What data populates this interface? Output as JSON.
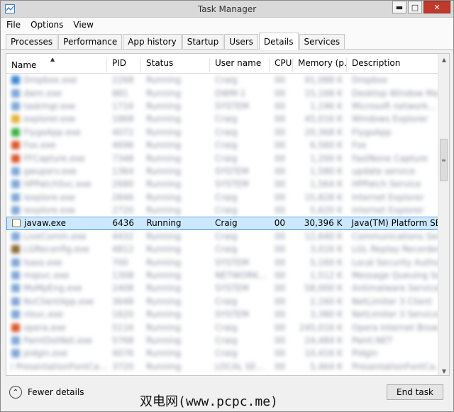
{
  "window": {
    "title": "Task Manager",
    "minimize": "▬",
    "maximize": "□",
    "close": "✕"
  },
  "menu": [
    "File",
    "Options",
    "View"
  ],
  "tabs": [
    "Processes",
    "Performance",
    "App history",
    "Startup",
    "Users",
    "Details",
    "Services"
  ],
  "active_tab": "Details",
  "columns": {
    "name": "Name",
    "pid": "PID",
    "status": "Status",
    "user": "User name",
    "cpu": "CPU",
    "memory": "Memory (p...",
    "description": "Description"
  },
  "selected_row": {
    "name": "javaw.exe",
    "pid": "6436",
    "status": "Running",
    "user": "Craig",
    "cpu": "00",
    "memory": "30,396 K",
    "description": "Java(TM) Platform SE..."
  },
  "blurred_rows": [
    {
      "icon_color": "#3a86d4",
      "name": "Dropbox.exe",
      "pid": "2268",
      "status": "Running",
      "user": "Craig",
      "cpu": "00",
      "mem": "91,088 K",
      "desc": "Dropbox"
    },
    {
      "icon_color": "#7fa7d6",
      "name": "dwm.exe",
      "pid": "881",
      "status": "Running",
      "user": "DWM-1",
      "cpu": "00",
      "mem": "15,168 K",
      "desc": "Desktop Window Ma..."
    },
    {
      "icon_color": "#7fa7d6",
      "name": "taskmgr.exe",
      "pid": "1716",
      "status": "Running",
      "user": "SYSTEM",
      "cpu": "00",
      "mem": "1,196 K",
      "desc": "Microsoft network..."
    },
    {
      "icon_color": "#e2b33a",
      "name": "explorer.exe",
      "pid": "1868",
      "status": "Running",
      "user": "Craig",
      "cpu": "00",
      "mem": "45,016 K",
      "desc": "Windows Explorer"
    },
    {
      "icon_color": "#3cb043",
      "name": "FlygoApp.exe",
      "pid": "4072",
      "status": "Running",
      "user": "Craig",
      "cpu": "00",
      "mem": "20,368 K",
      "desc": "FlygoApp"
    },
    {
      "icon_color": "#d9572f",
      "name": "Fox.exe",
      "pid": "4696",
      "status": "Running",
      "user": "Craig",
      "cpu": "00",
      "mem": "6,560 K",
      "desc": "Fox"
    },
    {
      "icon_color": "#d9572f",
      "name": "FFCapture.exe",
      "pid": "7348",
      "status": "Running",
      "user": "Craig",
      "cpu": "00",
      "mem": "1,200 K",
      "desc": "FastNone Capture"
    },
    {
      "icon_color": "#7fa7d6",
      "name": "gwupsrv.exe",
      "pid": "1364",
      "status": "Running",
      "user": "SYSTEM",
      "cpu": "00",
      "mem": "1,580 K",
      "desc": "update service"
    },
    {
      "icon_color": "#7fa7d6",
      "name": "HPPatchSvc.exe",
      "pid": "2680",
      "status": "Running",
      "user": "SYSTEM",
      "cpu": "00",
      "mem": "1,564 K",
      "desc": "HPPatch Service"
    },
    {
      "icon_color": "#7fa7d6",
      "name": "iexplore.exe",
      "pid": "2846",
      "status": "Running",
      "user": "Craig",
      "cpu": "00",
      "mem": "15,828 K",
      "desc": "Internet Explorer"
    },
    {
      "icon_color": "#7fa7d6",
      "name": "iexplore.exe",
      "pid": "2720",
      "status": "Running",
      "user": "Craig",
      "cpu": "00",
      "mem": "5,620 K",
      "desc": "Internet Explorer"
    },
    {
      "icon_color": "#7fa7d6",
      "name": "LiveComm.exe",
      "pid": "4432",
      "status": "Running",
      "user": "Craig",
      "cpu": "00",
      "mem": "12,640 K",
      "desc": "Communications Ser..."
    },
    {
      "icon_color": "#8a6a3a",
      "name": "LGReconfig.exe",
      "pid": "4812",
      "status": "Running",
      "user": "Craig",
      "cpu": "00",
      "mem": "3,016 K",
      "desc": "LGL Replay Recorder"
    },
    {
      "icon_color": "#7fa7d6",
      "name": "lsass.exe",
      "pid": "700",
      "status": "Running",
      "user": "SYSTEM",
      "cpu": "00",
      "mem": "5,160 K",
      "desc": "Local Security Authori..."
    },
    {
      "icon_color": "#7fa7d6",
      "name": "mqsvc.exe",
      "pid": "1308",
      "status": "Running",
      "user": "NETWORK...",
      "cpu": "00",
      "mem": "1,512 K",
      "desc": "Message Queuing Se..."
    },
    {
      "icon_color": "#7fa7d6",
      "name": "MsMpEng.exe",
      "pid": "2408",
      "status": "Running",
      "user": "SYSTEM",
      "cpu": "00",
      "mem": "58,000 K",
      "desc": "Antimalware Service..."
    },
    {
      "icon_color": "#7fa7d6",
      "name": "NvClientApp.exe",
      "pid": "3648",
      "status": "Running",
      "user": "Craig",
      "cpu": "00",
      "mem": "2,160 K",
      "desc": "NetLimiter 3 Client"
    },
    {
      "icon_color": "#7fa7d6",
      "name": "nlsvc.exe",
      "pid": "1620",
      "status": "Running",
      "user": "SYSTEM",
      "cpu": "00",
      "mem": "3,380 K",
      "desc": "NetLimiter 3 Service"
    },
    {
      "icon_color": "#d9572f",
      "name": "opera.exe",
      "pid": "5116",
      "status": "Running",
      "user": "Craig",
      "cpu": "00",
      "mem": "245,016 K",
      "desc": "Opera Internet Browser"
    },
    {
      "icon_color": "#7fa7d6",
      "name": "PaintDotNet.exe",
      "pid": "5768",
      "status": "Running",
      "user": "Craig",
      "cpu": "00",
      "mem": "24,484 K",
      "desc": "Paint.NET"
    },
    {
      "icon_color": "#7fa7d6",
      "name": "pidgin.exe",
      "pid": "4076",
      "status": "Running",
      "user": "Craig",
      "cpu": "00",
      "mem": "10,416 K",
      "desc": "Pidgin"
    },
    {
      "icon_color": "#7fa7d6",
      "name": "PresentationFontCa...",
      "pid": "3720",
      "status": "Running",
      "user": "LOCAL SE...",
      "cpu": "00",
      "mem": "5,464 K",
      "desc": "PresentationFontCa..."
    }
  ],
  "footer": {
    "fewer_details": "Fewer details",
    "end_task": "End task",
    "watermark": "双电网(www.pcpc.me)"
  },
  "icons": {
    "sort": "▲",
    "fewer": "⌃",
    "scroll_up": "▲",
    "scroll_down": "▼",
    "thumb_grip": "≡"
  }
}
